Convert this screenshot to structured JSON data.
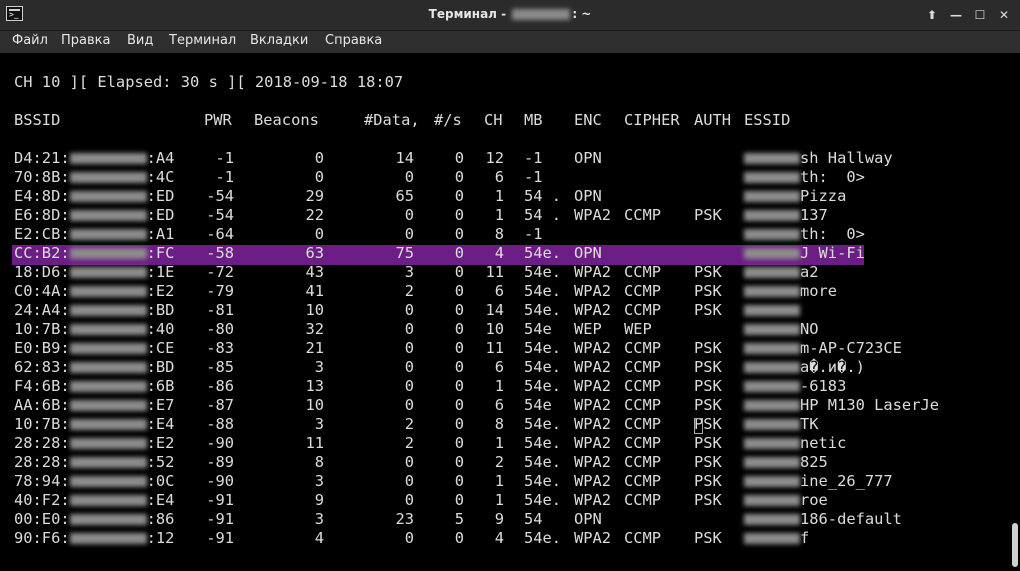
{
  "window": {
    "title_prefix": "Терминал - ",
    "title_suffix": ": ~",
    "buttons": [
      "⬆",
      "—",
      "☐",
      "✕"
    ]
  },
  "menu": [
    "Файл",
    "Правка",
    "Вид",
    "Терминал",
    "Вкладки",
    "Справка"
  ],
  "status_line": "CH 10 ][ Elapsed: 30 s ][ 2018-09-18 18:07",
  "columns": [
    "BSSID",
    "PWR",
    "Beacons",
    "#Data,",
    "#/s",
    "CH",
    "MB",
    "ENC",
    "CIPHER",
    "AUTH",
    "ESSID"
  ],
  "rows": [
    {
      "b1": "D4:21:",
      "b2": ":A4",
      "pwr": "-1",
      "beacons": "0",
      "data": "14",
      "ps": "0",
      "ch": "12",
      "mb": "-1",
      "enc": "OPN",
      "cipher": "",
      "auth": "",
      "essid": "sh Hallway"
    },
    {
      "b1": "70:8B:",
      "b2": ":4C",
      "pwr": "-1",
      "beacons": "0",
      "data": "0",
      "ps": "0",
      "ch": "6",
      "mb": "-1",
      "enc": "",
      "cipher": "",
      "auth": "",
      "essid": "th:  0>"
    },
    {
      "b1": "E4:8D:",
      "b2": ":ED",
      "pwr": "-54",
      "beacons": "29",
      "data": "65",
      "ps": "0",
      "ch": "1",
      "mb": "54 .",
      "enc": "OPN",
      "cipher": "",
      "auth": "",
      "essid": "Pizza"
    },
    {
      "b1": "E6:8D:",
      "b2": ":ED",
      "pwr": "-54",
      "beacons": "22",
      "data": "0",
      "ps": "0",
      "ch": "1",
      "mb": "54 .",
      "enc": "WPA2",
      "cipher": "CCMP",
      "auth": "PSK",
      "essid": "137"
    },
    {
      "b1": "E2:CB:",
      "b2": ":A1",
      "pwr": "-64",
      "beacons": "0",
      "data": "0",
      "ps": "0",
      "ch": "8",
      "mb": "-1",
      "enc": "",
      "cipher": "",
      "auth": "",
      "essid": "th:  0>"
    },
    {
      "b1": "CC:B2:",
      "b2": ":FC",
      "pwr": "-58",
      "beacons": "63",
      "data": "75",
      "ps": "0",
      "ch": "4",
      "mb": "54e.",
      "enc": "OPN",
      "cipher": "",
      "auth": "",
      "essid": "J Wi-Fi"
    },
    {
      "b1": "18:D6:",
      "b2": ":1E",
      "pwr": "-72",
      "beacons": "43",
      "data": "3",
      "ps": "0",
      "ch": "11",
      "mb": "54e.",
      "enc": "WPA2",
      "cipher": "CCMP",
      "auth": "PSK",
      "essid": "a2"
    },
    {
      "b1": "C0:4A:",
      "b2": ":E2",
      "pwr": "-79",
      "beacons": "41",
      "data": "2",
      "ps": "0",
      "ch": "6",
      "mb": "54e.",
      "enc": "WPA2",
      "cipher": "CCMP",
      "auth": "PSK",
      "essid": "more"
    },
    {
      "b1": "24:A4:",
      "b2": ":BD",
      "pwr": "-81",
      "beacons": "10",
      "data": "0",
      "ps": "0",
      "ch": "14",
      "mb": "54e.",
      "enc": "WPA2",
      "cipher": "CCMP",
      "auth": "PSK",
      "essid": ""
    },
    {
      "b1": "10:7B:",
      "b2": ":40",
      "pwr": "-80",
      "beacons": "32",
      "data": "0",
      "ps": "0",
      "ch": "10",
      "mb": "54e",
      "enc": "WEP",
      "cipher": "WEP",
      "auth": "",
      "essid": "NO"
    },
    {
      "b1": "E0:B9:",
      "b2": ":CE",
      "pwr": "-83",
      "beacons": "21",
      "data": "0",
      "ps": "0",
      "ch": "11",
      "mb": "54e.",
      "enc": "WPA2",
      "cipher": "CCMP",
      "auth": "PSK",
      "essid": "m-AP-C723CE"
    },
    {
      "b1": "62:83:",
      "b2": ":BD",
      "pwr": "-85",
      "beacons": "3",
      "data": "0",
      "ps": "0",
      "ch": "6",
      "mb": "54e.",
      "enc": "WPA2",
      "cipher": "CCMP",
      "auth": "PSK",
      "essid": "а�.и�.)"
    },
    {
      "b1": "F4:6B:",
      "b2": ":6B",
      "pwr": "-86",
      "beacons": "13",
      "data": "0",
      "ps": "0",
      "ch": "1",
      "mb": "54e.",
      "enc": "WPA2",
      "cipher": "CCMP",
      "auth": "PSK",
      "essid": "-6183"
    },
    {
      "b1": "AA:6B:",
      "b2": ":E7",
      "pwr": "-87",
      "beacons": "10",
      "data": "0",
      "ps": "0",
      "ch": "6",
      "mb": "54e",
      "enc": "WPA2",
      "cipher": "CCMP",
      "auth": "PSK",
      "essid": "HP M130 LaserJe"
    },
    {
      "b1": "10:7B:",
      "b2": ":E4",
      "pwr": "-88",
      "beacons": "3",
      "data": "2",
      "ps": "0",
      "ch": "8",
      "mb": "54e.",
      "enc": "WPA2",
      "cipher": "CCMP",
      "auth": "PSK",
      "essid": "TK"
    },
    {
      "b1": "28:28:",
      "b2": ":E2",
      "pwr": "-90",
      "beacons": "11",
      "data": "2",
      "ps": "0",
      "ch": "1",
      "mb": "54e.",
      "enc": "WPA2",
      "cipher": "CCMP",
      "auth": "PSK",
      "essid": "netic"
    },
    {
      "b1": "28:28:",
      "b2": ":52",
      "pwr": "-89",
      "beacons": "8",
      "data": "0",
      "ps": "0",
      "ch": "2",
      "mb": "54e.",
      "enc": "WPA2",
      "cipher": "CCMP",
      "auth": "PSK",
      "essid": "825"
    },
    {
      "b1": "78:94:",
      "b2": ":0C",
      "pwr": "-90",
      "beacons": "3",
      "data": "0",
      "ps": "0",
      "ch": "1",
      "mb": "54e.",
      "enc": "WPA2",
      "cipher": "CCMP",
      "auth": "PSK",
      "essid": "ine_26_777"
    },
    {
      "b1": "40:F2:",
      "b2": ":E4",
      "pwr": "-91",
      "beacons": "9",
      "data": "0",
      "ps": "0",
      "ch": "1",
      "mb": "54e.",
      "enc": "WPA2",
      "cipher": "CCMP",
      "auth": "PSK",
      "essid": "roe"
    },
    {
      "b1": "00:E0:",
      "b2": ":86",
      "pwr": "-91",
      "beacons": "3",
      "data": "23",
      "ps": "5",
      "ch": "9",
      "mb": "54",
      "enc": "OPN",
      "cipher": "",
      "auth": "",
      "essid": "186-default"
    },
    {
      "b1": "90:F6:",
      "b2": ":12",
      "pwr": "-91",
      "beacons": "4",
      "data": "0",
      "ps": "0",
      "ch": "4",
      "mb": "54e.",
      "enc": "WPA2",
      "cipher": "CCMP",
      "auth": "PSK",
      "essid": "f"
    }
  ]
}
